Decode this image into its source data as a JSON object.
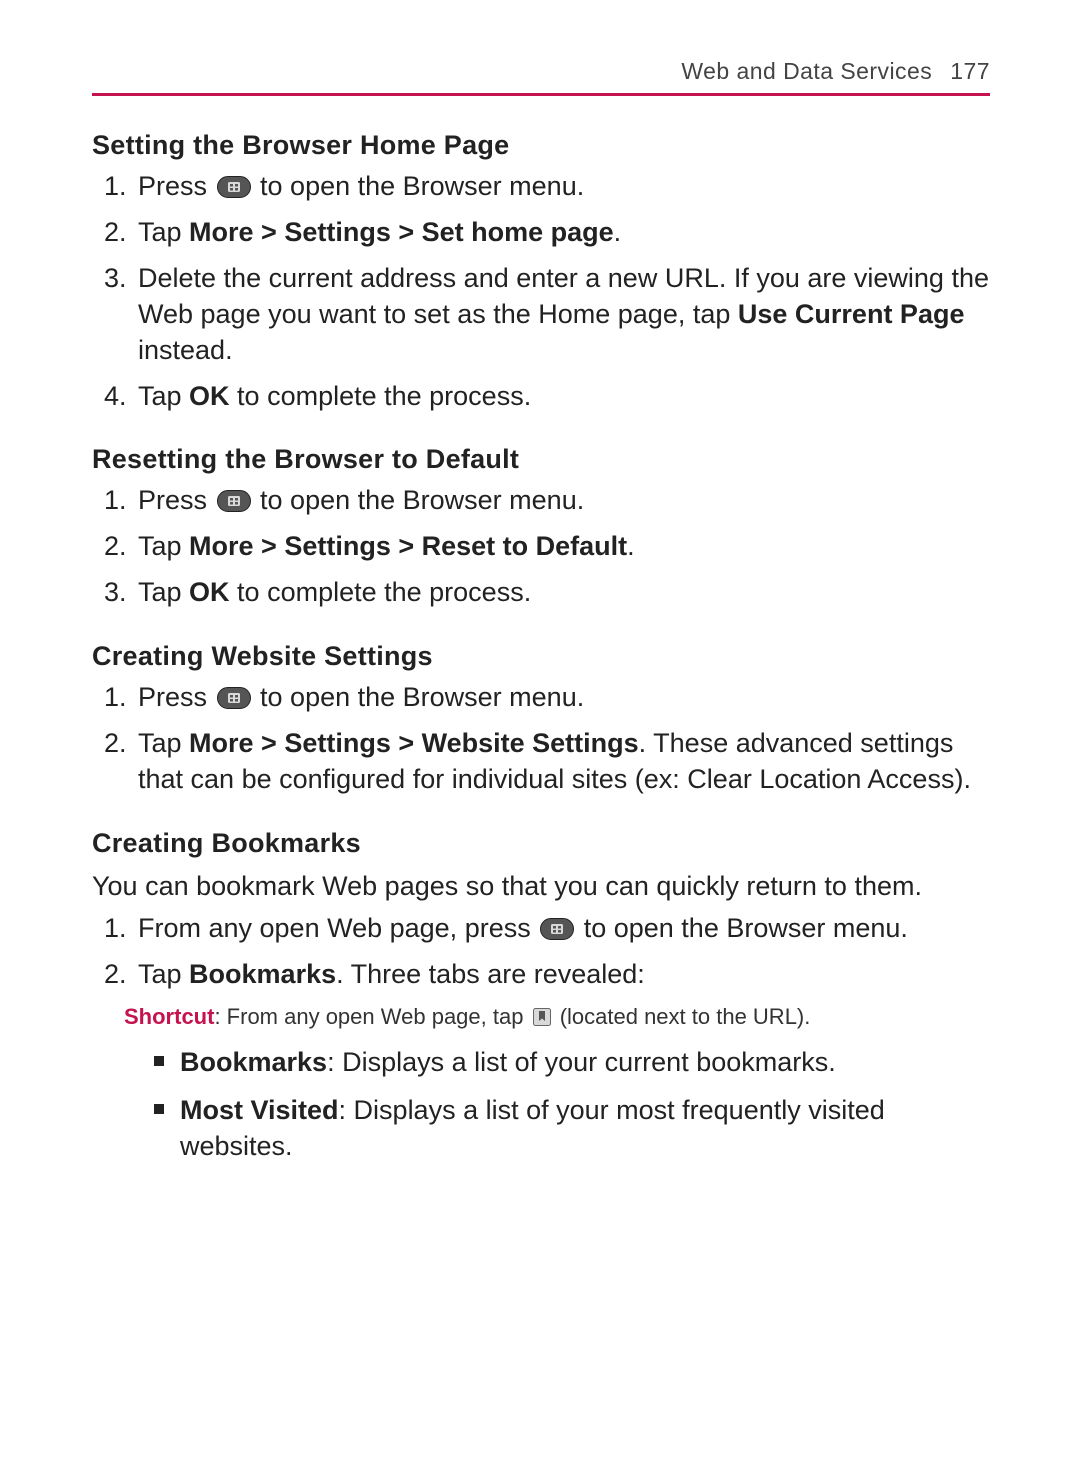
{
  "header": {
    "section": "Web and Data Services",
    "page_number": "177"
  },
  "sections": [
    {
      "title": "Setting the Browser Home Page",
      "intro": "",
      "steps": [
        {
          "pre": "Press ",
          "icon": "menu",
          "post": " to open the Browser menu."
        },
        {
          "pre": "Tap ",
          "bold": "More > Settings > Set home page",
          "post": "."
        },
        {
          "pre": "Delete the current address and enter a new URL. If you are viewing the Web page you want to set as the Home page, tap ",
          "bold": "Use Current Page",
          "post": " instead."
        },
        {
          "pre": "Tap ",
          "bold": "OK",
          "post": " to complete the process."
        }
      ]
    },
    {
      "title": "Resetting the Browser to Default",
      "steps": [
        {
          "pre": "Press ",
          "icon": "menu",
          "post": " to open the Browser menu."
        },
        {
          "pre": "Tap ",
          "bold": "More > Settings > Reset to Default",
          "post": "."
        },
        {
          "pre": "Tap ",
          "bold": "OK",
          "post": " to complete the process."
        }
      ]
    },
    {
      "title": "Creating Website Settings",
      "steps": [
        {
          "pre": "Press ",
          "icon": "menu",
          "post": " to open the Browser menu."
        },
        {
          "pre": "Tap ",
          "bold": "More > Settings > Website Settings",
          "post": ". These advanced settings that can be configured for individual sites (ex: Clear Location Access)."
        }
      ]
    },
    {
      "title": "Creating Bookmarks",
      "intro": "You can bookmark Web pages so that you can quickly return to them.",
      "steps": [
        {
          "pre": "From any open Web page, press ",
          "icon": "menu",
          "post": " to open the Browser menu."
        },
        {
          "pre": "Tap ",
          "bold": "Bookmarks",
          "post": ". Three tabs are revealed:"
        }
      ],
      "note": {
        "label": "Shortcut",
        "pre": ": From any open Web page, tap ",
        "icon": "bookmark",
        "post": " (located next to the URL)."
      },
      "bullets": [
        {
          "bold": "Bookmarks",
          "post": ": Displays a list of your current bookmarks."
        },
        {
          "bold": "Most Visited",
          "post": ": Displays a list of your most frequently visited websites."
        }
      ]
    }
  ]
}
